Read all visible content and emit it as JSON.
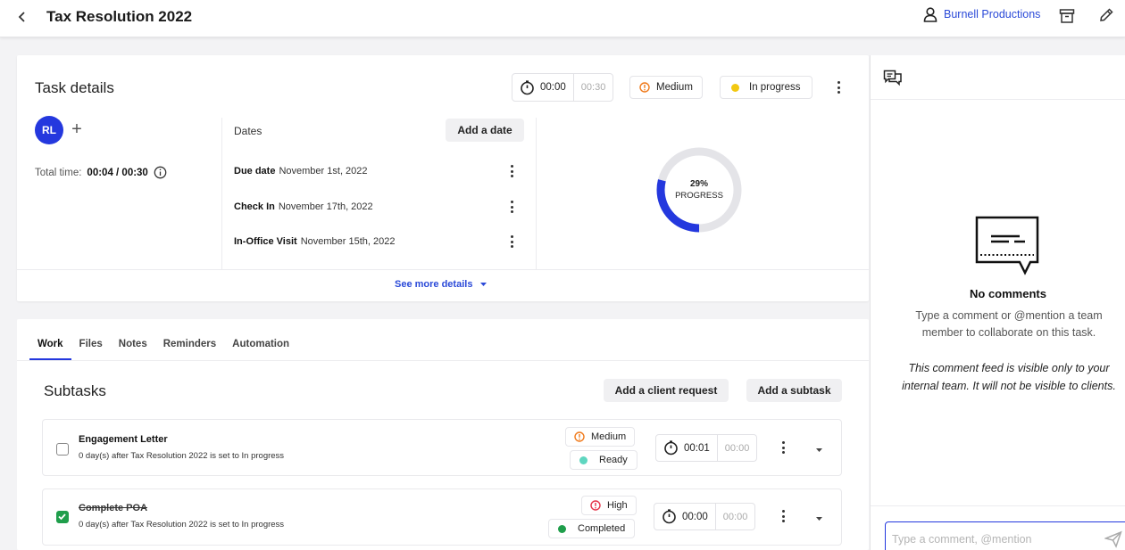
{
  "header": {
    "title": "Tax Resolution 2022",
    "client_name": "Burnell Productions"
  },
  "task": {
    "title": "Task details",
    "timer_current": "00:00",
    "timer_estimate": "00:30",
    "priority": "Medium",
    "status": "In progress",
    "assignee_initials": "RL",
    "total_time_label": "Total time:",
    "total_time_value": "00:04 / 00:30",
    "dates_label": "Dates",
    "add_date_label": "Add a date",
    "dates": [
      {
        "label": "Due date",
        "value": "November 1st, 2022"
      },
      {
        "label": "Check In",
        "value": "November 17th, 2022"
      },
      {
        "label": "In-Office Visit",
        "value": "November 15th, 2022"
      }
    ],
    "progress_percent": 29,
    "progress_pct_text": "29%",
    "progress_label": "PROGRESS",
    "see_more_label": "See more details"
  },
  "tabs": [
    "Work",
    "Files",
    "Notes",
    "Reminders",
    "Automation"
  ],
  "subtasks": {
    "title": "Subtasks",
    "add_client_request_label": "Add a client request",
    "add_subtask_label": "Add a subtask",
    "items": [
      {
        "name": "Engagement Letter",
        "description": "0 day(s) after Tax Resolution 2022 is set to In progress",
        "priority": "Medium",
        "status": "Ready",
        "timer_current": "00:01",
        "timer_estimate": "00:00",
        "checked": false
      },
      {
        "name": "Complete POA",
        "description": "0 day(s) after Tax Resolution 2022 is set to In progress",
        "priority": "High",
        "status": "Completed",
        "timer_current": "00:00",
        "timer_estimate": "00:00",
        "checked": true
      }
    ]
  },
  "comments": {
    "empty_title": "No comments",
    "hint": "Type a comment or @mention a team member to collaborate on this task.",
    "note": "This comment feed is visible only to your internal team. It will not be visible to clients.",
    "input_placeholder": "Type a comment, @mention"
  },
  "colors": {
    "accent": "#2438de",
    "link": "#2b4ad8",
    "priority_medium": "#f07b1d",
    "priority_high": "#e5344a",
    "status_in_progress": "#f2c811",
    "status_ready": "#5fd6c0",
    "status_completed": "#1f9e4b",
    "progress_track": "#e4e4e8"
  },
  "icons": {
    "back": "chevron-left-icon",
    "client": "user-icon",
    "archive": "archive-icon",
    "edit": "pencil-icon",
    "timer": "stopwatch-icon",
    "priority": "alert-circle-icon",
    "info": "info-icon",
    "comments": "chat-bubbles-icon",
    "empty_comments": "message-box-icon",
    "send": "send-icon"
  }
}
